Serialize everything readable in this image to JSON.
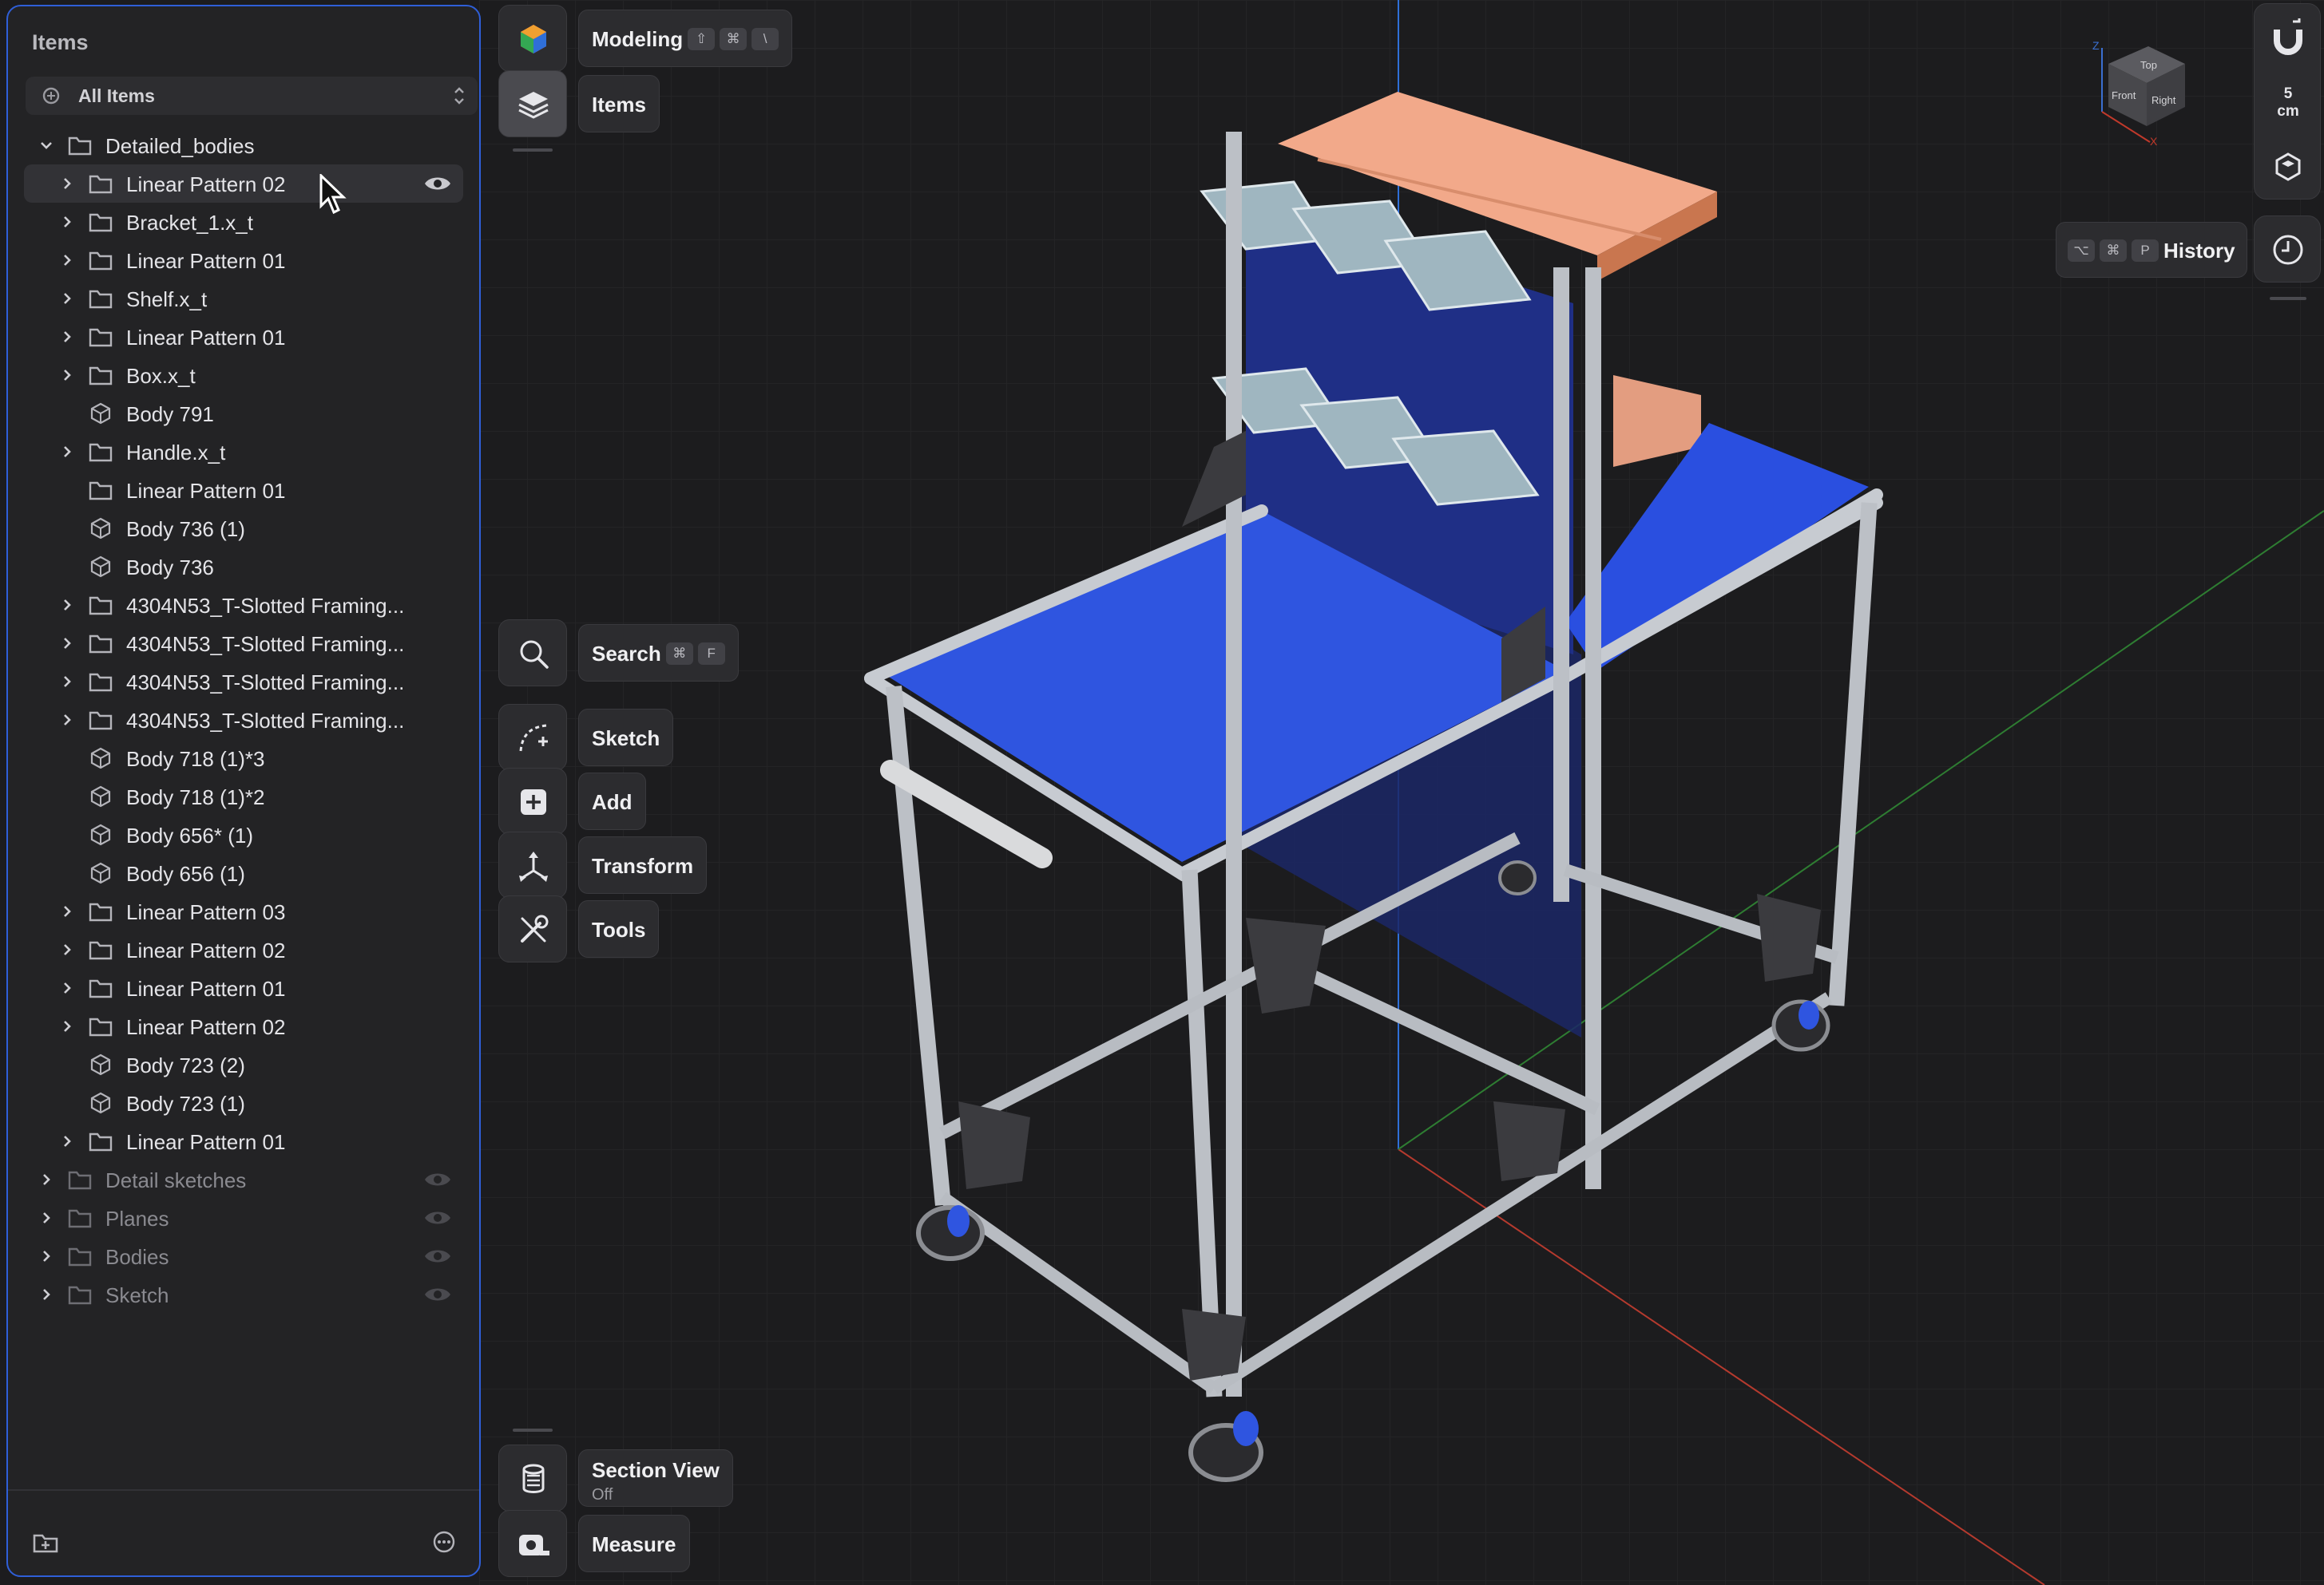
{
  "panel": {
    "title": "Items",
    "filter_label": "All Items",
    "tree": [
      {
        "label": "Detailed_bodies",
        "depth": 0,
        "kind": "folder",
        "expanded": true,
        "dim": false
      },
      {
        "label": "Linear Pattern 02",
        "depth": 1,
        "kind": "folder",
        "expander": true,
        "selected": true,
        "eye": true
      },
      {
        "label": "Bracket_1.x_t",
        "depth": 1,
        "kind": "folder",
        "expander": true
      },
      {
        "label": "Linear Pattern 01",
        "depth": 1,
        "kind": "folder",
        "expander": true
      },
      {
        "label": "Shelf.x_t",
        "depth": 1,
        "kind": "folder",
        "expander": true
      },
      {
        "label": "Linear Pattern 01",
        "depth": 1,
        "kind": "folder",
        "expander": true
      },
      {
        "label": "Box.x_t",
        "depth": 1,
        "kind": "folder",
        "expander": true
      },
      {
        "label": "Body 791",
        "depth": 1,
        "kind": "body",
        "expander": false
      },
      {
        "label": "Handle.x_t",
        "depth": 1,
        "kind": "folder",
        "expander": true
      },
      {
        "label": "Linear Pattern 01",
        "depth": 1,
        "kind": "folder",
        "expander": false
      },
      {
        "label": "Body 736 (1)",
        "depth": 1,
        "kind": "body",
        "expander": false
      },
      {
        "label": "Body 736",
        "depth": 1,
        "kind": "body",
        "expander": false
      },
      {
        "label": "4304N53_T-Slotted Framing...",
        "depth": 1,
        "kind": "folder",
        "expander": true
      },
      {
        "label": "4304N53_T-Slotted Framing...",
        "depth": 1,
        "kind": "folder",
        "expander": true
      },
      {
        "label": "4304N53_T-Slotted Framing...",
        "depth": 1,
        "kind": "folder",
        "expander": true
      },
      {
        "label": "4304N53_T-Slotted Framing...",
        "depth": 1,
        "kind": "folder",
        "expander": true
      },
      {
        "label": "Body 718 (1)*3",
        "depth": 1,
        "kind": "body",
        "expander": false
      },
      {
        "label": "Body 718 (1)*2",
        "depth": 1,
        "kind": "body",
        "expander": false
      },
      {
        "label": "Body 656* (1)",
        "depth": 1,
        "kind": "body",
        "expander": false
      },
      {
        "label": "Body 656 (1)",
        "depth": 1,
        "kind": "body",
        "expander": false
      },
      {
        "label": "Linear Pattern 03",
        "depth": 1,
        "kind": "folder",
        "expander": true
      },
      {
        "label": "Linear Pattern 02",
        "depth": 1,
        "kind": "folder",
        "expander": true
      },
      {
        "label": "Linear Pattern 01",
        "depth": 1,
        "kind": "folder",
        "expander": true
      },
      {
        "label": "Linear Pattern 02",
        "depth": 1,
        "kind": "folder",
        "expander": true
      },
      {
        "label": "Body 723 (2)",
        "depth": 1,
        "kind": "body",
        "expander": false
      },
      {
        "label": "Body 723 (1)",
        "depth": 1,
        "kind": "body",
        "expander": false
      },
      {
        "label": "Linear Pattern 01",
        "depth": 1,
        "kind": "folder",
        "expander": true
      },
      {
        "label": "Detail sketches",
        "depth": 0,
        "kind": "folder",
        "expander": true,
        "dim": true,
        "hidden": true
      },
      {
        "label": "Planes",
        "depth": 0,
        "kind": "folder",
        "expander": true,
        "dim": true,
        "hidden": true
      },
      {
        "label": "Bodies",
        "depth": 0,
        "kind": "folder",
        "expander": true,
        "dim": true,
        "hidden": true
      },
      {
        "label": "Sketch",
        "depth": 0,
        "kind": "folder",
        "expander": true,
        "dim": true,
        "hidden": true
      }
    ]
  },
  "toolbar": {
    "modeling": {
      "label": "Modeling",
      "shortcut": [
        "⇧",
        "⌘",
        "\\"
      ]
    },
    "items": {
      "label": "Items"
    },
    "search": {
      "label": "Search",
      "shortcut": [
        "⌘",
        "F"
      ]
    },
    "sketch": {
      "label": "Sketch"
    },
    "add": {
      "label": "Add"
    },
    "transform": {
      "label": "Transform"
    },
    "tools": {
      "label": "Tools"
    },
    "section_view": {
      "label": "Section View",
      "state": "Off"
    },
    "measure": {
      "label": "Measure"
    }
  },
  "right": {
    "grid_unit_value": "5",
    "grid_unit": "cm",
    "history": {
      "label": "History",
      "shortcut": [
        "⌥",
        "⌘",
        "P"
      ]
    },
    "view_cube": {
      "top": "Top",
      "front": "Front",
      "right": "Right",
      "axis_z": "Z",
      "axis_x": "X"
    }
  },
  "colors": {
    "accent": "#2f5fd8",
    "table_blue": "#2f55e0",
    "back_panel_blue": "#1f2f86",
    "tray_orange": "#f2a98a",
    "frame_grey": "#bcc0c6",
    "bin_steel": "#9fb6c0",
    "axis_red": "#c0392b",
    "axis_green": "#2e7d32",
    "axis_blue": "#2f6fd8"
  },
  "icons": {
    "search": "search-icon",
    "sketch": "sketch-curve-icon",
    "add": "add-square-icon",
    "transform": "transform-arrows-icon",
    "tools": "wrench-icon",
    "section": "section-view-icon",
    "measure": "tape-measure-icon",
    "history": "clock-icon",
    "magnet": "magnet-icon",
    "mode": "modeling-cube-icon",
    "layers": "layers-icon"
  }
}
